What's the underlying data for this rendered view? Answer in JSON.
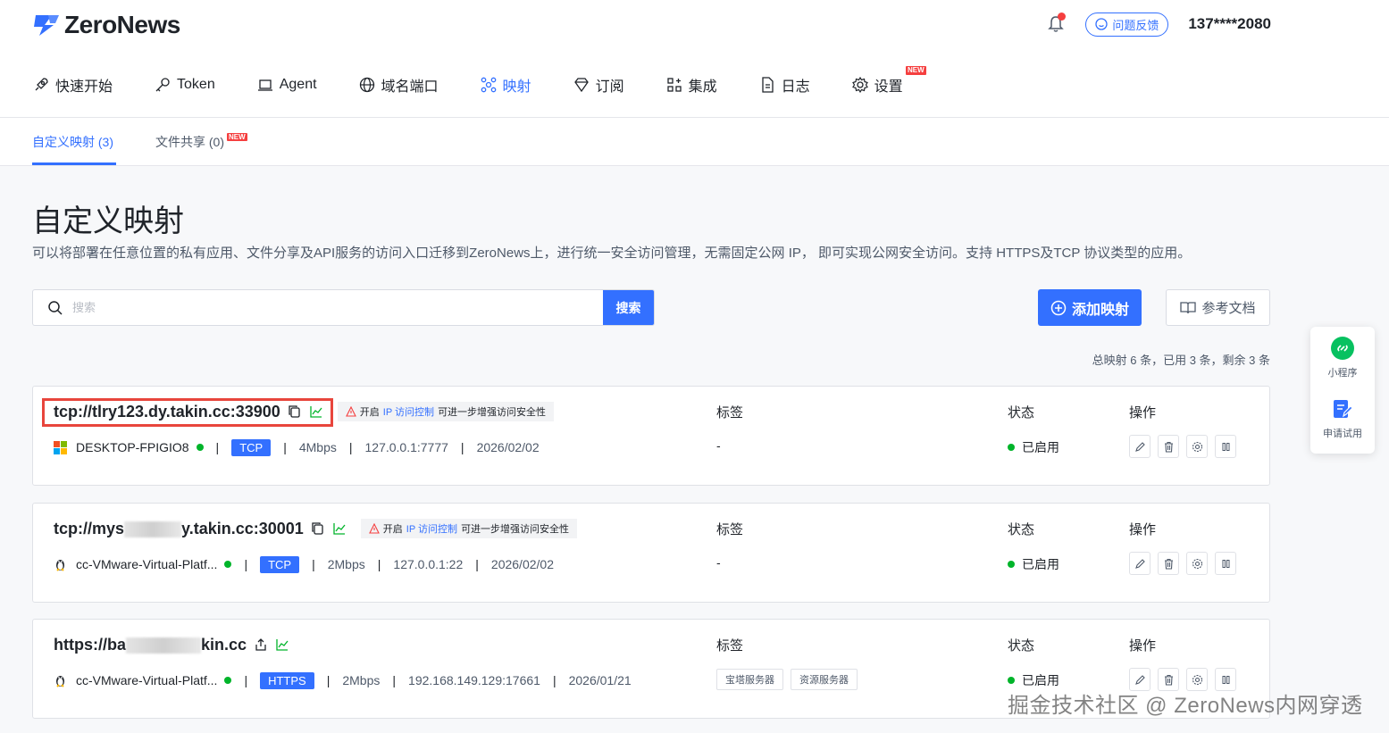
{
  "brand": {
    "name": "ZeroNews"
  },
  "header": {
    "feedback_label": "问题反馈",
    "user": "137****2080"
  },
  "nav": [
    {
      "label": "快速开始",
      "icon": "rocket-icon"
    },
    {
      "label": "Token",
      "icon": "key-icon"
    },
    {
      "label": "Agent",
      "icon": "laptop-icon"
    },
    {
      "label": "域名端口",
      "icon": "globe-icon"
    },
    {
      "label": "映射",
      "icon": "mapping-icon",
      "active": true
    },
    {
      "label": "订阅",
      "icon": "diamond-icon"
    },
    {
      "label": "集成",
      "icon": "grid-plus-icon"
    },
    {
      "label": "日志",
      "icon": "document-icon"
    },
    {
      "label": "设置",
      "icon": "gear-icon",
      "badge": "NEW"
    }
  ],
  "subtabs": [
    {
      "label": "自定义映射 (3)",
      "active": true
    },
    {
      "label": "文件共享 (0)",
      "badge": "NEW"
    }
  ],
  "page": {
    "title": "自定义映射",
    "description": "可以将部署在任意位置的私有应用、文件分享及API服务的访问入口迁移到ZeroNews上，进行统一安全访问管理，无需固定公网 IP， 即可实现公网安全访问。支持 HTTPS及TCP 协议类型的应用。"
  },
  "search": {
    "placeholder": "搜索",
    "button": "搜索"
  },
  "actions": {
    "add": "添加映射",
    "docs": "参考文档"
  },
  "quota": "总映射 6 条，已用 3 条，剩余 3 条",
  "columns": {
    "tags": "标签",
    "status": "状态",
    "ops": "操作"
  },
  "warning": {
    "prefix": "开启",
    "link": "IP 访问控制",
    "suffix": "可进一步增强访问安全性"
  },
  "mappings": [
    {
      "addr_start": "tcp://tlry123.dy.takin.cc:33900",
      "addr_end": "",
      "os": "windows-icon",
      "host": "DESKTOP-FPIGIO8",
      "protocol": "TCP",
      "bandwidth": "4Mbps",
      "local": "127.0.0.1:7777",
      "date": "2026/02/02",
      "tags_text": "-",
      "status": "已启用"
    },
    {
      "addr_start": "tcp://mys",
      "addr_end": "y.takin.cc:30001",
      "os": "linux-icon",
      "host": "cc-VMware-Virtual-Platf...",
      "protocol": "TCP",
      "bandwidth": "2Mbps",
      "local": "127.0.0.1:22",
      "date": "2026/02/02",
      "tags_text": "-",
      "status": "已启用"
    },
    {
      "addr_start": "https://ba",
      "addr_end": "kin.cc",
      "os": "linux-icon",
      "host": "cc-VMware-Virtual-Platf...",
      "protocol": "HTTPS",
      "bandwidth": "2Mbps",
      "local": "192.168.149.129:17661",
      "date": "2026/01/21",
      "tags": [
        "宝塔服务器",
        "资源服务器"
      ],
      "status": "已启用"
    }
  ],
  "side": {
    "miniprogram": "小程序",
    "trial": "申请试用"
  },
  "watermark": "掘金技术社区 @ ZeroNews内网穿透",
  "colors": {
    "primary": "#3370ff",
    "success": "#00b42a",
    "danger": "#f53f3f"
  }
}
